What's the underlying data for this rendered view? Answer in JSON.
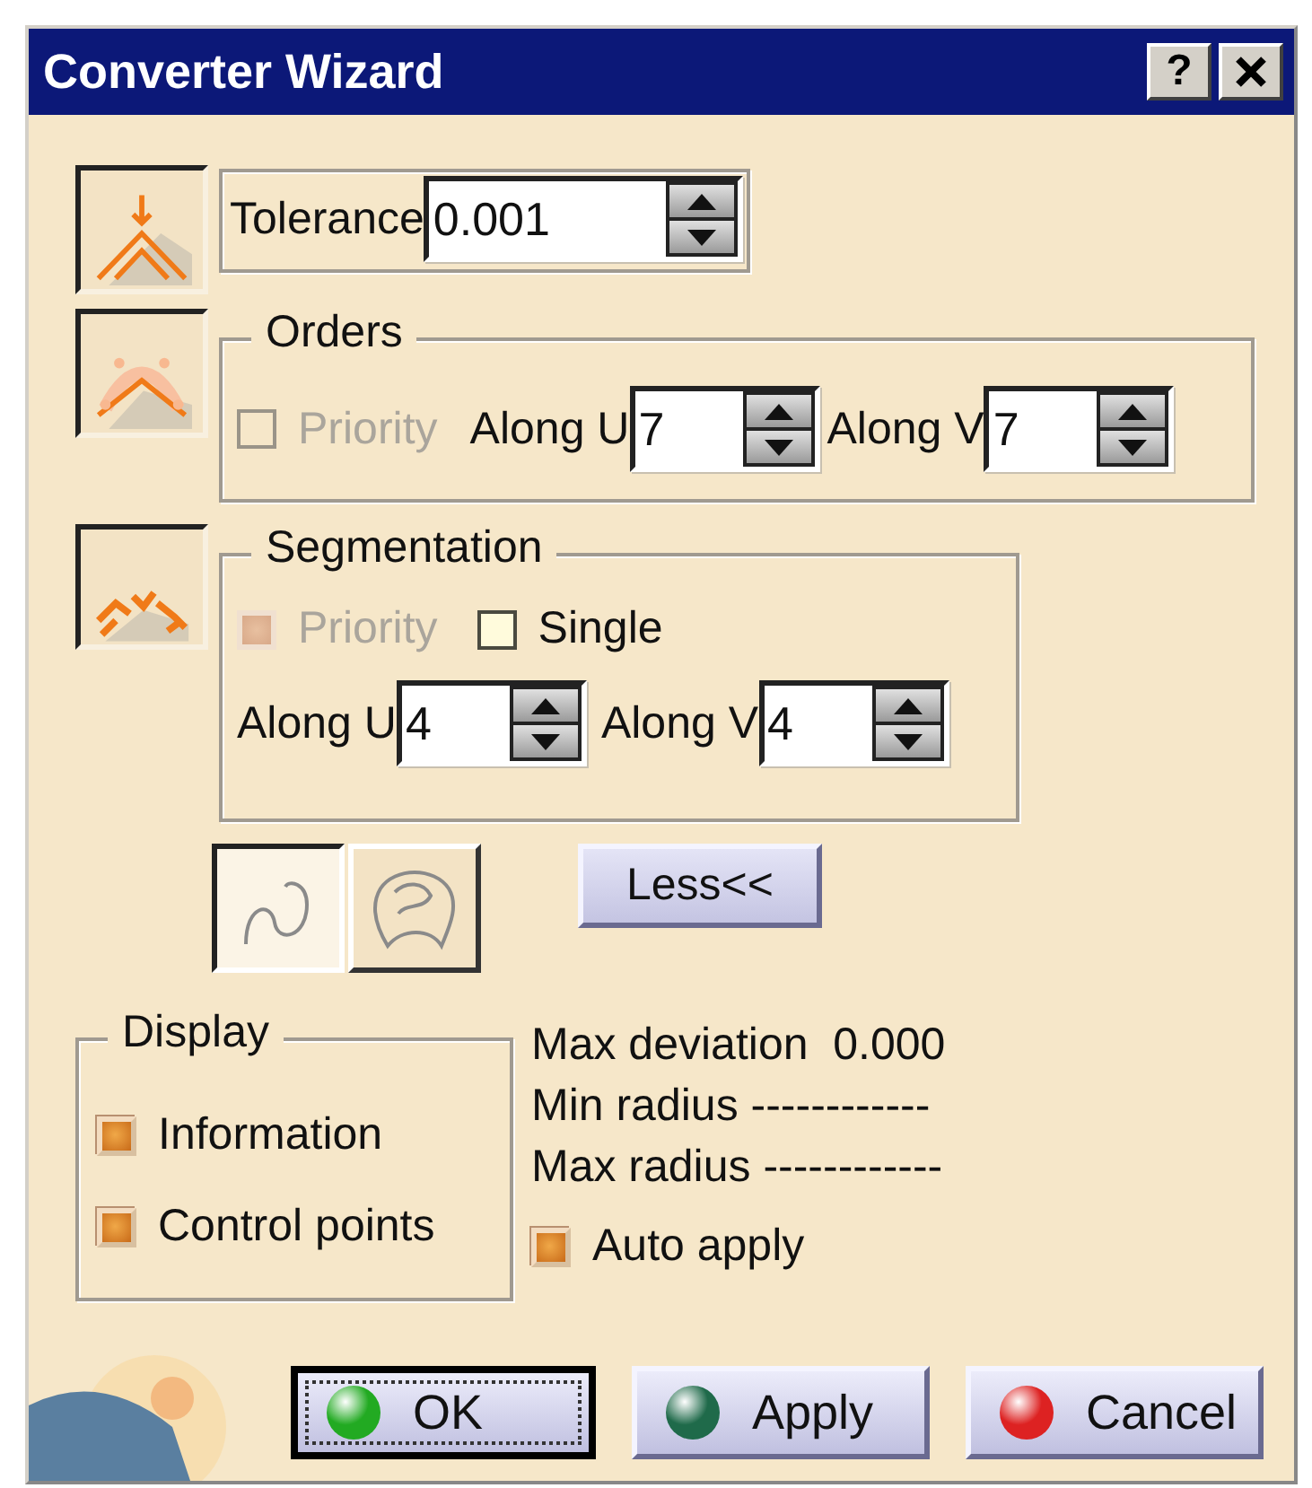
{
  "window": {
    "title": "Converter Wizard",
    "help": "?"
  },
  "tolerance": {
    "label": "Tolerance",
    "value": "0.001"
  },
  "orders": {
    "legend": "Orders",
    "priority": {
      "label": "Priority",
      "checked": false,
      "disabled": true
    },
    "along_u": {
      "label": "Along U",
      "value": "7"
    },
    "along_v": {
      "label": "Along V",
      "value": "7"
    }
  },
  "segmentation": {
    "legend": "Segmentation",
    "priority": {
      "label": "Priority",
      "checked": true,
      "disabled": true
    },
    "single": {
      "label": "Single",
      "checked": false,
      "disabled": false
    },
    "along_u": {
      "label": "Along U",
      "value": "4"
    },
    "along_v": {
      "label": "Along V",
      "value": "4"
    }
  },
  "mode_toggles": [
    {
      "kind": "curve",
      "selected": true
    },
    {
      "kind": "surface",
      "selected": false
    }
  ],
  "less_button": "Less<<",
  "display": {
    "legend": "Display",
    "options": [
      {
        "label": "Information",
        "checked": true
      },
      {
        "label": "Control points",
        "checked": true
      }
    ]
  },
  "info": [
    "Max deviation  0.000",
    "Min radius ------------",
    "Max radius ------------"
  ],
  "auto_apply": {
    "label": "Auto apply",
    "checked": true
  },
  "buttons": [
    {
      "label": "OK",
      "default": true,
      "color": "#22aa22"
    },
    {
      "label": "Apply",
      "default": false,
      "color": "#1f6a4a"
    },
    {
      "label": "Cancel",
      "default": false,
      "color": "#dd2222"
    }
  ]
}
